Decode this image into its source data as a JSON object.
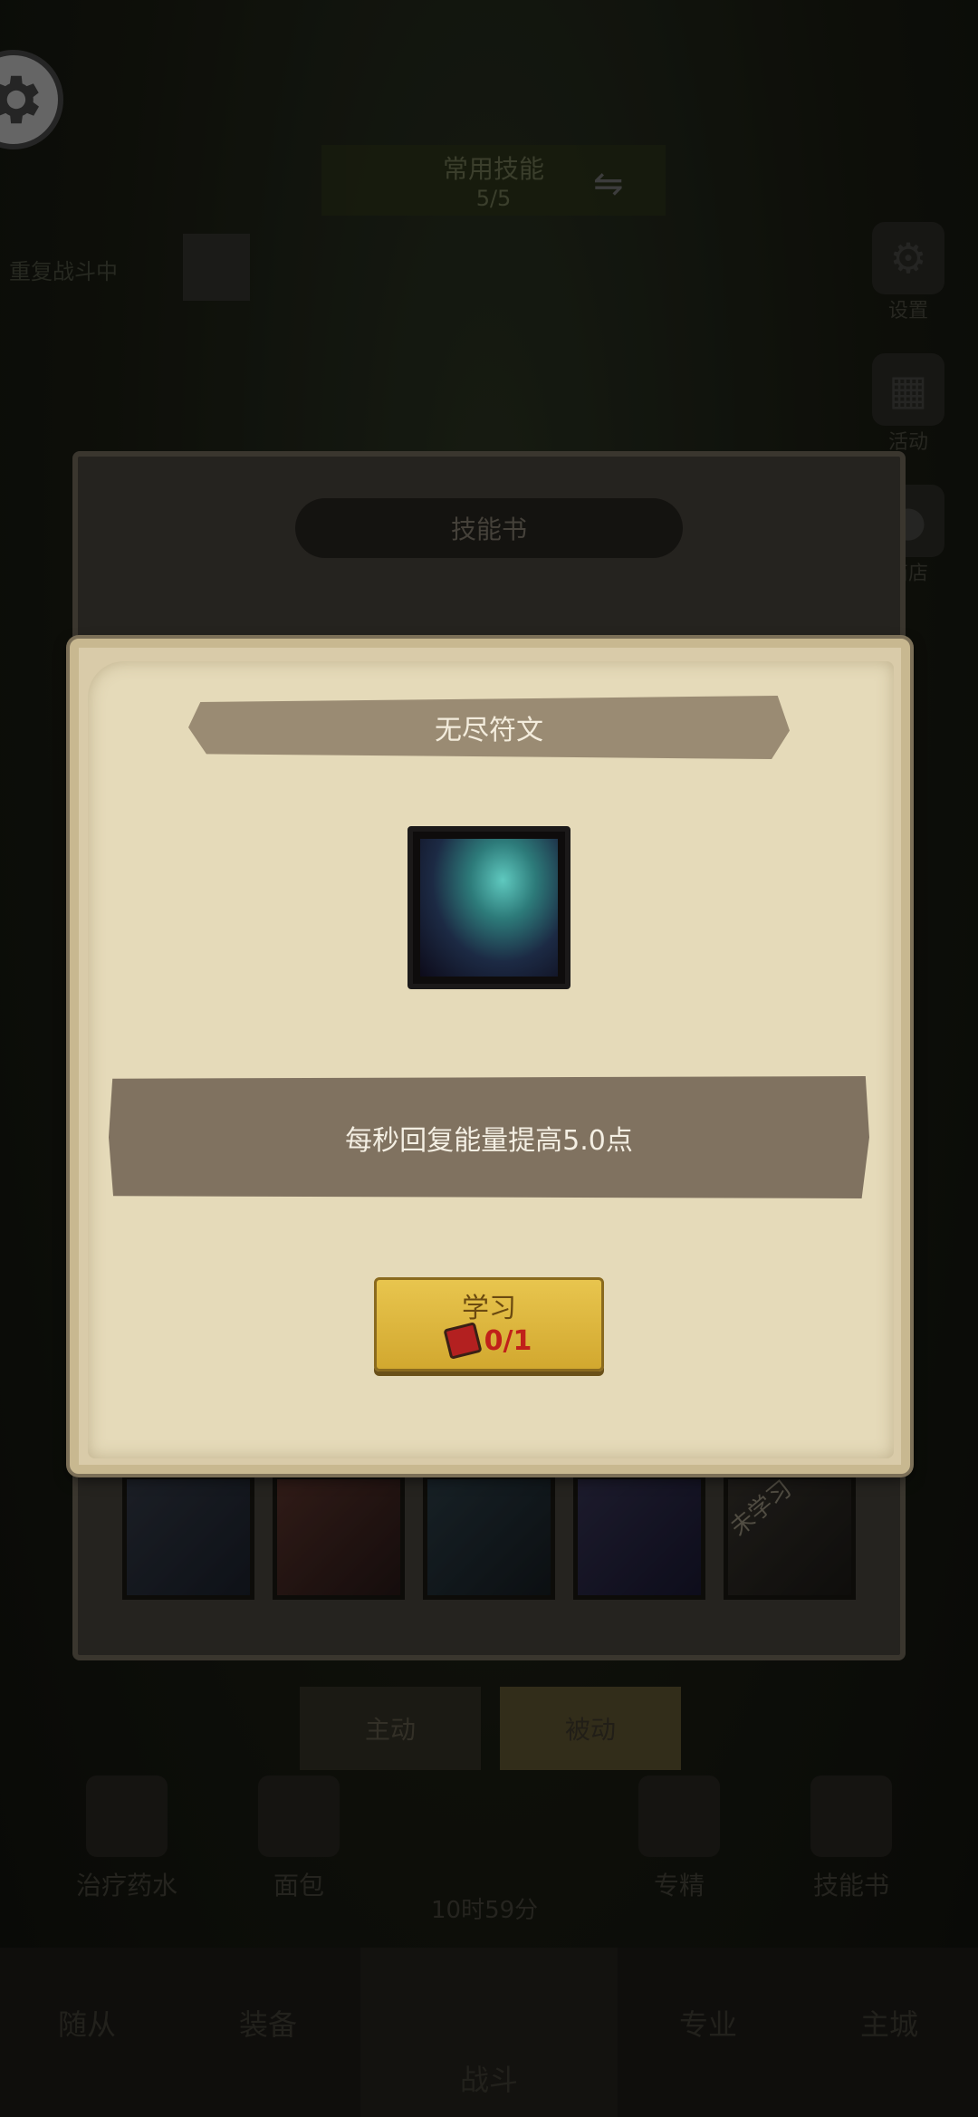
{
  "background": {
    "banner_title": "常用技能",
    "banner_sub": "5/5",
    "left_label": "重复战斗中",
    "side_buttons": [
      "设置",
      "活动",
      "商店"
    ],
    "skill_book_title": "技能书",
    "slot_tag": "未学习",
    "tabs": {
      "active": "主动",
      "passive": "被动"
    },
    "items": [
      "治疗药水",
      "面包",
      "专精",
      "技能书"
    ],
    "timer": "10时59分",
    "nav": [
      "随从",
      "装备",
      "战斗",
      "专业",
      "主城"
    ]
  },
  "modal": {
    "title": "无尽符文",
    "description": "每秒回复能量提高5.0点",
    "learn_button": {
      "label": "学习",
      "cost": "0/1"
    }
  },
  "colors": {
    "modal_bg": "#e5dab9",
    "title_ribbon": "#9a8b73",
    "desc_bar": "#807260",
    "button_yellow": "#e0b93f",
    "cost_red": "#c0201a"
  }
}
